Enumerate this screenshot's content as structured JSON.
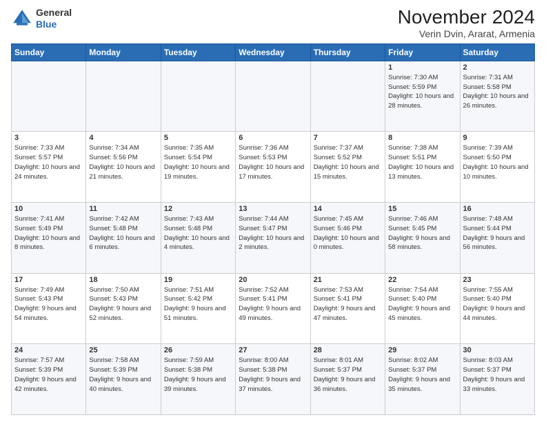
{
  "header": {
    "logo": {
      "general": "General",
      "blue": "Blue"
    },
    "title": "November 2024",
    "location": "Verin Dvin, Ararat, Armenia"
  },
  "weekdays": [
    "Sunday",
    "Monday",
    "Tuesday",
    "Wednesday",
    "Thursday",
    "Friday",
    "Saturday"
  ],
  "weeks": [
    [
      {
        "day": "",
        "info": ""
      },
      {
        "day": "",
        "info": ""
      },
      {
        "day": "",
        "info": ""
      },
      {
        "day": "",
        "info": ""
      },
      {
        "day": "",
        "info": ""
      },
      {
        "day": "1",
        "info": "Sunrise: 7:30 AM\nSunset: 5:59 PM\nDaylight: 10 hours and 28 minutes."
      },
      {
        "day": "2",
        "info": "Sunrise: 7:31 AM\nSunset: 5:58 PM\nDaylight: 10 hours and 26 minutes."
      }
    ],
    [
      {
        "day": "3",
        "info": "Sunrise: 7:33 AM\nSunset: 5:57 PM\nDaylight: 10 hours and 24 minutes."
      },
      {
        "day": "4",
        "info": "Sunrise: 7:34 AM\nSunset: 5:56 PM\nDaylight: 10 hours and 21 minutes."
      },
      {
        "day": "5",
        "info": "Sunrise: 7:35 AM\nSunset: 5:54 PM\nDaylight: 10 hours and 19 minutes."
      },
      {
        "day": "6",
        "info": "Sunrise: 7:36 AM\nSunset: 5:53 PM\nDaylight: 10 hours and 17 minutes."
      },
      {
        "day": "7",
        "info": "Sunrise: 7:37 AM\nSunset: 5:52 PM\nDaylight: 10 hours and 15 minutes."
      },
      {
        "day": "8",
        "info": "Sunrise: 7:38 AM\nSunset: 5:51 PM\nDaylight: 10 hours and 13 minutes."
      },
      {
        "day": "9",
        "info": "Sunrise: 7:39 AM\nSunset: 5:50 PM\nDaylight: 10 hours and 10 minutes."
      }
    ],
    [
      {
        "day": "10",
        "info": "Sunrise: 7:41 AM\nSunset: 5:49 PM\nDaylight: 10 hours and 8 minutes."
      },
      {
        "day": "11",
        "info": "Sunrise: 7:42 AM\nSunset: 5:48 PM\nDaylight: 10 hours and 6 minutes."
      },
      {
        "day": "12",
        "info": "Sunrise: 7:43 AM\nSunset: 5:48 PM\nDaylight: 10 hours and 4 minutes."
      },
      {
        "day": "13",
        "info": "Sunrise: 7:44 AM\nSunset: 5:47 PM\nDaylight: 10 hours and 2 minutes."
      },
      {
        "day": "14",
        "info": "Sunrise: 7:45 AM\nSunset: 5:46 PM\nDaylight: 10 hours and 0 minutes."
      },
      {
        "day": "15",
        "info": "Sunrise: 7:46 AM\nSunset: 5:45 PM\nDaylight: 9 hours and 58 minutes."
      },
      {
        "day": "16",
        "info": "Sunrise: 7:48 AM\nSunset: 5:44 PM\nDaylight: 9 hours and 56 minutes."
      }
    ],
    [
      {
        "day": "17",
        "info": "Sunrise: 7:49 AM\nSunset: 5:43 PM\nDaylight: 9 hours and 54 minutes."
      },
      {
        "day": "18",
        "info": "Sunrise: 7:50 AM\nSunset: 5:43 PM\nDaylight: 9 hours and 52 minutes."
      },
      {
        "day": "19",
        "info": "Sunrise: 7:51 AM\nSunset: 5:42 PM\nDaylight: 9 hours and 51 minutes."
      },
      {
        "day": "20",
        "info": "Sunrise: 7:52 AM\nSunset: 5:41 PM\nDaylight: 9 hours and 49 minutes."
      },
      {
        "day": "21",
        "info": "Sunrise: 7:53 AM\nSunset: 5:41 PM\nDaylight: 9 hours and 47 minutes."
      },
      {
        "day": "22",
        "info": "Sunrise: 7:54 AM\nSunset: 5:40 PM\nDaylight: 9 hours and 45 minutes."
      },
      {
        "day": "23",
        "info": "Sunrise: 7:55 AM\nSunset: 5:40 PM\nDaylight: 9 hours and 44 minutes."
      }
    ],
    [
      {
        "day": "24",
        "info": "Sunrise: 7:57 AM\nSunset: 5:39 PM\nDaylight: 9 hours and 42 minutes."
      },
      {
        "day": "25",
        "info": "Sunrise: 7:58 AM\nSunset: 5:39 PM\nDaylight: 9 hours and 40 minutes."
      },
      {
        "day": "26",
        "info": "Sunrise: 7:59 AM\nSunset: 5:38 PM\nDaylight: 9 hours and 39 minutes."
      },
      {
        "day": "27",
        "info": "Sunrise: 8:00 AM\nSunset: 5:38 PM\nDaylight: 9 hours and 37 minutes."
      },
      {
        "day": "28",
        "info": "Sunrise: 8:01 AM\nSunset: 5:37 PM\nDaylight: 9 hours and 36 minutes."
      },
      {
        "day": "29",
        "info": "Sunrise: 8:02 AM\nSunset: 5:37 PM\nDaylight: 9 hours and 35 minutes."
      },
      {
        "day": "30",
        "info": "Sunrise: 8:03 AM\nSunset: 5:37 PM\nDaylight: 9 hours and 33 minutes."
      }
    ]
  ]
}
